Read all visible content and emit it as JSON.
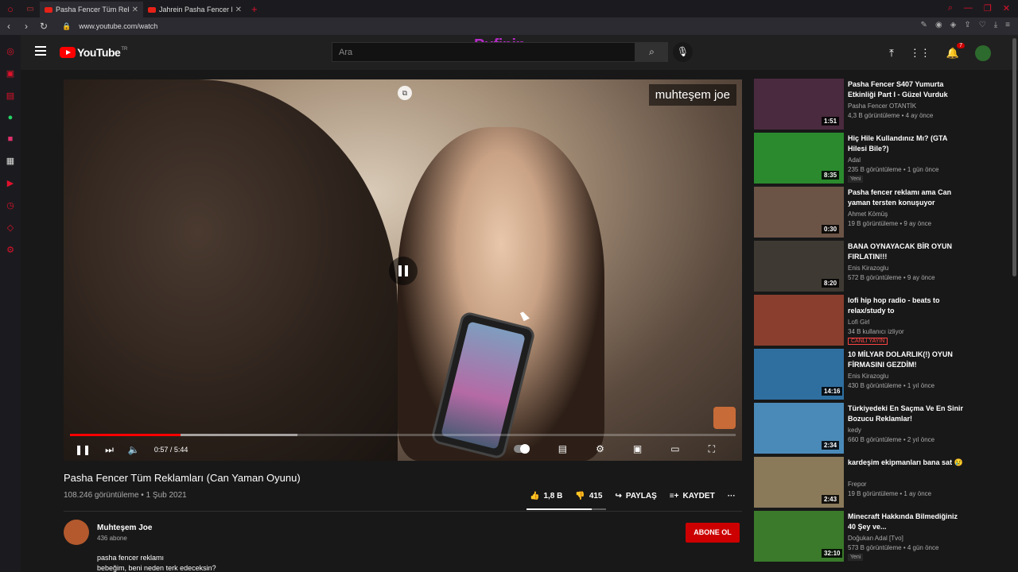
{
  "browser": {
    "tabs": [
      {
        "title": "Pasha Fencer Tüm Reklamları",
        "active": true
      },
      {
        "title": "Jahrein Pasha Fencer Mobil",
        "active": false
      }
    ],
    "url": "www.youtube.com/watch"
  },
  "header": {
    "logo_text": "YouTube",
    "logo_sup": "TR",
    "search_placeholder": "Ara",
    "watermark": "Pufipin",
    "notif_count": "7"
  },
  "player": {
    "channel_watermark": "muhteşem joe",
    "time": "0:57 / 5:44",
    "progress_played": 0.166,
    "progress_buffered": 0.342
  },
  "video": {
    "title": "Pasha Fencer Tüm Reklamları (Can Yaman Oyunu)",
    "views": "108.246 görüntüleme • 1 Şub 2021",
    "likes": "1,8 B",
    "dislikes": "415",
    "share": "PAYLAŞ",
    "save": "KAYDET",
    "like_ratio": 0.82
  },
  "channel": {
    "name": "Muhteşem Joe",
    "subs": "436 abone",
    "subscribe_label": "ABONE OL",
    "desc_line1": "pasha fencer reklamı",
    "desc_line2": "bebeğim, beni neden terk edeceksin?"
  },
  "recommendations": [
    {
      "title": "Pasha Fencer S407 Yumurta Etkinliği Part I - Güzel Vurduk",
      "channel": "Pasha Fencer OTANTİK",
      "meta": "4,3 B görüntüleme • 4 ay önce",
      "duration": "1:51",
      "tag": "",
      "color": "#4a2a3e"
    },
    {
      "title": "Hiç Hile Kullandınız Mı? (GTA Hilesi Bile?)",
      "channel": "Adal",
      "meta": "235 B görüntüleme • 1 gün önce",
      "duration": "8:35",
      "tag": "Yeni",
      "color": "#2b8a2e"
    },
    {
      "title": "Pasha fencer reklamı ama Can yaman tersten konuşuyor",
      "channel": "Ahmet Kömüş",
      "meta": "19 B görüntüleme • 9 ay önce",
      "duration": "0:30",
      "tag": "",
      "color": "#6b5446"
    },
    {
      "title": "BANA OYNAYACAK BİR OYUN FIRLATIN!!!",
      "channel": "Enis Kirazoglu",
      "meta": "572 B görüntüleme • 9 ay önce",
      "duration": "8:20",
      "tag": "",
      "color": "#3e3a33"
    },
    {
      "title": "lofi hip hop radio - beats to relax/study to",
      "channel": "Lofi Girl",
      "meta": "34 B kullanıcı izliyor",
      "duration": "",
      "tag": "CANLI YAYIN",
      "color": "#8a3e2e"
    },
    {
      "title": "10 MİLYAR DOLARLIK(!) OYUN FİRMASINI GEZDİM!",
      "channel": "Enis Kirazoglu",
      "meta": "430 B görüntüleme • 1 yıl önce",
      "duration": "14:16",
      "tag": "",
      "color": "#2f6fa0"
    },
    {
      "title": "Türkiyedeki En Saçma Ve En Sinir Bozucu Reklamlar!",
      "channel": "kedy",
      "meta": "660 B görüntüleme • 2 yıl önce",
      "duration": "2:34",
      "tag": "",
      "color": "#4a8ab8"
    },
    {
      "title": "kardeşim ekipmanları bana sat 😢",
      "channel": "Frepor",
      "meta": "19 B görüntüleme • 1 ay önce",
      "duration": "2:43",
      "tag": "",
      "color": "#8a7a5a"
    },
    {
      "title": "Minecraft Hakkında Bilmediğiniz 40 Şey ve...",
      "channel": "Doğukan Adal [Tvo]",
      "meta": "573 B görüntüleme • 4 gün önce",
      "duration": "32:10",
      "tag": "Yeni",
      "color": "#3a7a2a"
    }
  ]
}
